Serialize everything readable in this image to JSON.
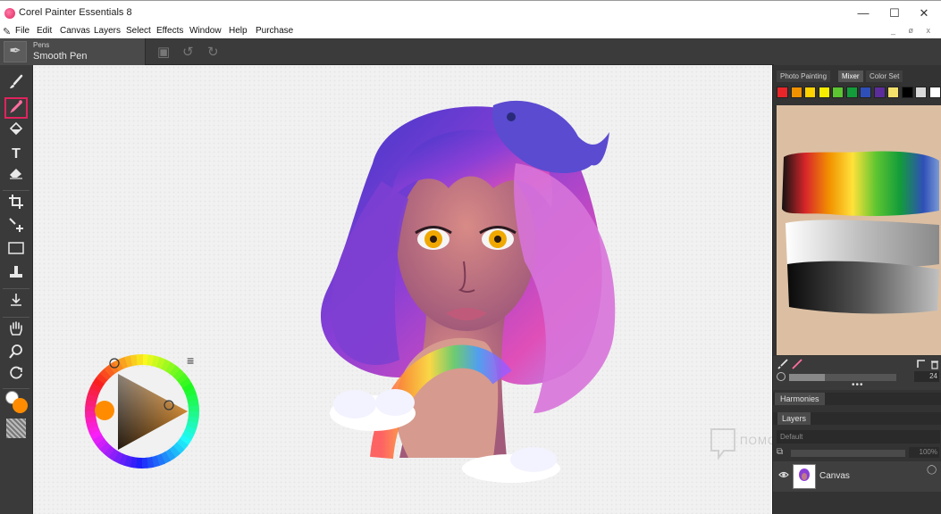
{
  "window": {
    "title": "Corel Painter Essentials 8",
    "minimize_glyph": "—",
    "maximize_glyph": "☐",
    "close_glyph": "✕"
  },
  "menu": {
    "items": [
      "File",
      "Edit",
      "Canvas",
      "Layers",
      "Select",
      "Effects",
      "Window",
      "Help",
      "Purchase"
    ],
    "right_glyphs": "_ ø x"
  },
  "property_bar": {
    "brush_category": "Pens",
    "brush_variant": "Smooth Pen",
    "save_icon": "💾",
    "undo_icon": "↺",
    "redo_icon": "↻"
  },
  "toolbox": {
    "brush_icon": "🖌",
    "dropper_icon": "⁄",
    "paint_bucket_icon": "◈",
    "text_icon": "T",
    "eraser_icon": "⌫",
    "crop_icon": "⌗",
    "transform_icon": "✥",
    "rect_select_icon": "▭",
    "clone_icon": "⤒",
    "smudge_icon": "⚲",
    "grabber_icon": "✋",
    "magnifier_icon": "⚲",
    "rotate_icon": "↻"
  },
  "colors": {
    "main_color": "#ff8c00",
    "additional_color": "#ffffff",
    "accent": "#e0245e"
  },
  "color_wheel": {
    "menu_icon": "≡"
  },
  "mixer": {
    "tabs": [
      "Photo Painting",
      "Mixer",
      "Color Set"
    ],
    "active_tab": "Mixer",
    "swatches": [
      "#e8262a",
      "#f29100",
      "#ffd200",
      "#f5ec00",
      "#5cc531",
      "#139c3a",
      "#2f4fb8",
      "#5b2d9b",
      "#f4e16c",
      "#000000",
      "#d9d9d9",
      "#ffffff"
    ],
    "brush_size": "24",
    "more_icon": "•••"
  },
  "harmonies": {
    "tab_label": "Harmonies"
  },
  "layers": {
    "tab_label": "Layers",
    "blend_mode": "Default",
    "opacity": "100%",
    "opacity_icon": "⧉",
    "eye_icon": "👁",
    "layer_name": "Canvas",
    "layer_options_icon": "◯"
  },
  "watermark": {
    "text": "ПОМОЩНИКИ"
  }
}
